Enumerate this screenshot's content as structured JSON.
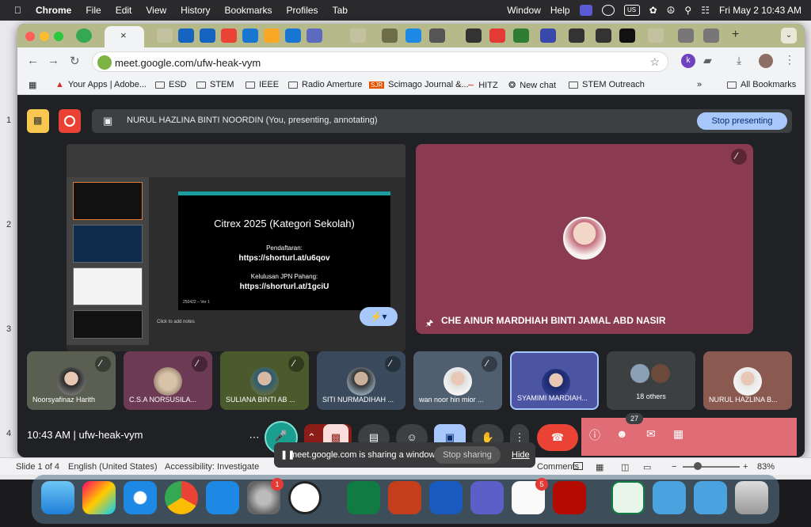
{
  "menubar": {
    "app": "Chrome",
    "items": [
      "File",
      "Edit",
      "View",
      "History",
      "Bookmarks",
      "Profiles",
      "Tab",
      "Window",
      "Help"
    ],
    "lang": "US",
    "datetime": "Fri May 2  10:43 AM"
  },
  "browser": {
    "url": "meet.google.com/ufw-heak-vym",
    "bookmarks": [
      "Your Apps | Adobe...",
      "ESD",
      "STEM",
      "IEEE",
      "Radio Amerture",
      "Scimago Journal &...",
      "HITZ",
      "New chat",
      "STEM Outreach"
    ],
    "all_bookmarks": "All Bookmarks"
  },
  "meet": {
    "banner_text": "NURUL HAZLINA BINTI NOORDIN (You, presenting, annotating)",
    "stop_presenting": "Stop presenting",
    "slide": {
      "title": "Citrex 2025 (Kategori Sekolah)",
      "reg_label": "Pendaftaran:",
      "reg_url": "https://shorturl.at/u6qov",
      "jpn_label": "Kelulusan JPN Pahang:",
      "jpn_url": "https://shorturl.at/1gciU",
      "footer": "250422 – Ver 1",
      "notes": "Click to add notes"
    },
    "presenter_name": "CHE AINUR MARDHIAH BINTI JAMAL ABD NASIR",
    "participants": [
      "Noorsyafinaz Harith",
      "C.S.A NORSUSILA...",
      "SULIANA BINTI AB ...",
      "SITI NURMADIHAH ...",
      "wan noor hin mior ...",
      "SYAMIMI MARDIAH...",
      "18 others",
      "NURUL HAZLINA B..."
    ],
    "time_code": "10:43 AM   |   ufw-heak-vym",
    "people_count": "27"
  },
  "system": {
    "share_text": "meet.google.com is sharing a window.",
    "stop_sharing": "Stop sharing",
    "hide": "Hide",
    "line_numbers": [
      "1",
      "2",
      "3",
      "4"
    ]
  },
  "statusbar": {
    "slide_of": "Slide 1 of 4",
    "language": "English (United States)",
    "accessibility": "Accessibility: Investigate",
    "comments": "Comments",
    "zoom": "83%"
  },
  "dock": {
    "settings_badge": "1",
    "store_badge": "5"
  }
}
